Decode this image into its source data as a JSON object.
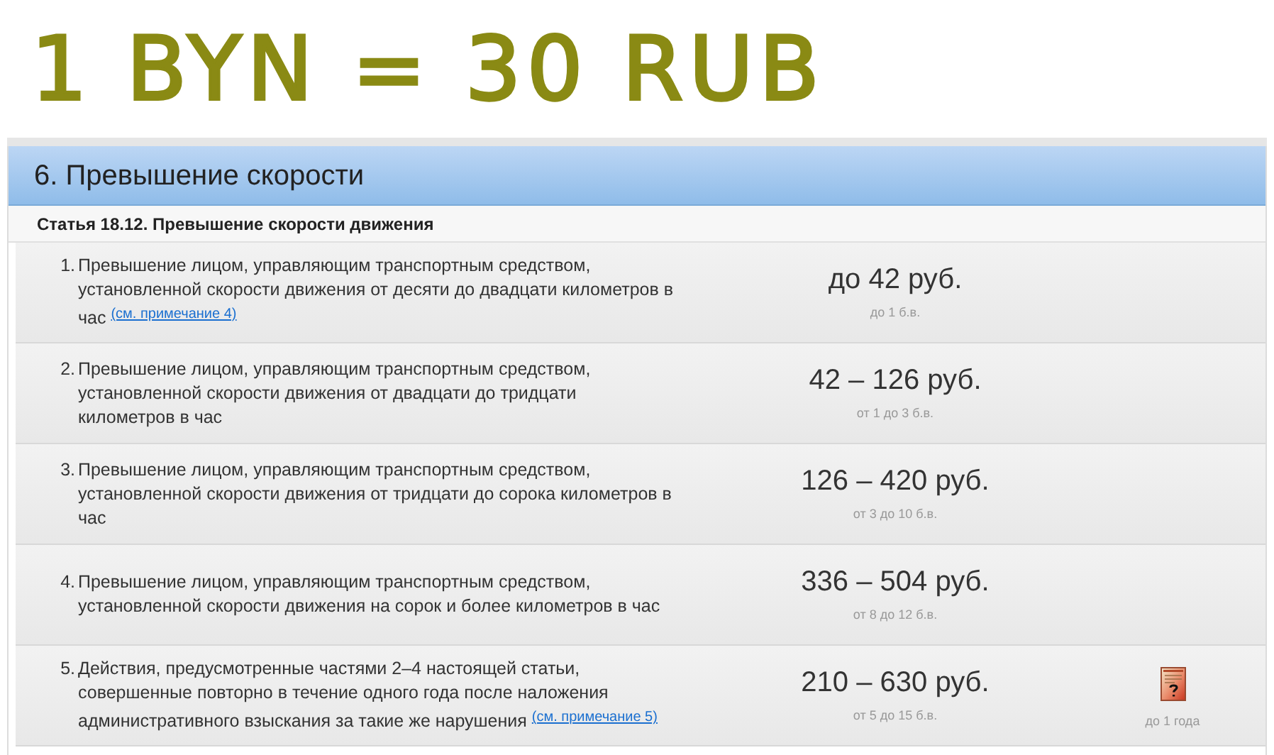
{
  "annotation": "1 BYN = 30 RUB",
  "section": {
    "title": "6. Превышение скорости"
  },
  "article": "Статья 18.12. Превышение скорости движения",
  "rows": [
    {
      "number": "1.",
      "text": "Превышение лицом, управляющим транспортным средством, установленной скорости движения от десяти до двадцати километров в час",
      "note": "(см. примечание 4)",
      "fine": "до 42 руб.",
      "base": "до 1 б.в."
    },
    {
      "number": "2.",
      "text": "Превышение лицом, управляющим транспортным средством, установленной скорости движения от двадцати до тридцати километров в час",
      "fine": "42 – 126 руб.",
      "base": "от 1 до 3 б.в."
    },
    {
      "number": "3.",
      "text": "Превышение лицом, управляющим транспортным средством, установленной скорости движения от тридцати до сорока километров в час",
      "fine": "126 – 420 руб.",
      "base": "от 3 до 10 б.в."
    },
    {
      "number": "4.",
      "text": "Превышение лицом, управляющим транспортным средством, установленной скорости движения на сорок и более километров в час",
      "fine": "336 – 504 руб.",
      "base": "от 8 до 12 б.в."
    },
    {
      "number": "5.",
      "text": "Действия, предусмотренные частями 2–4 настоящей статьи, совершенные повторно в течение одного года после наложения административного взыскания за такие же нарушения",
      "note": "(см. примечание 5)",
      "fine": "210 – 630 руб.",
      "base": "от 5 до 15 б.в.",
      "extra": "до 1 года"
    }
  ]
}
